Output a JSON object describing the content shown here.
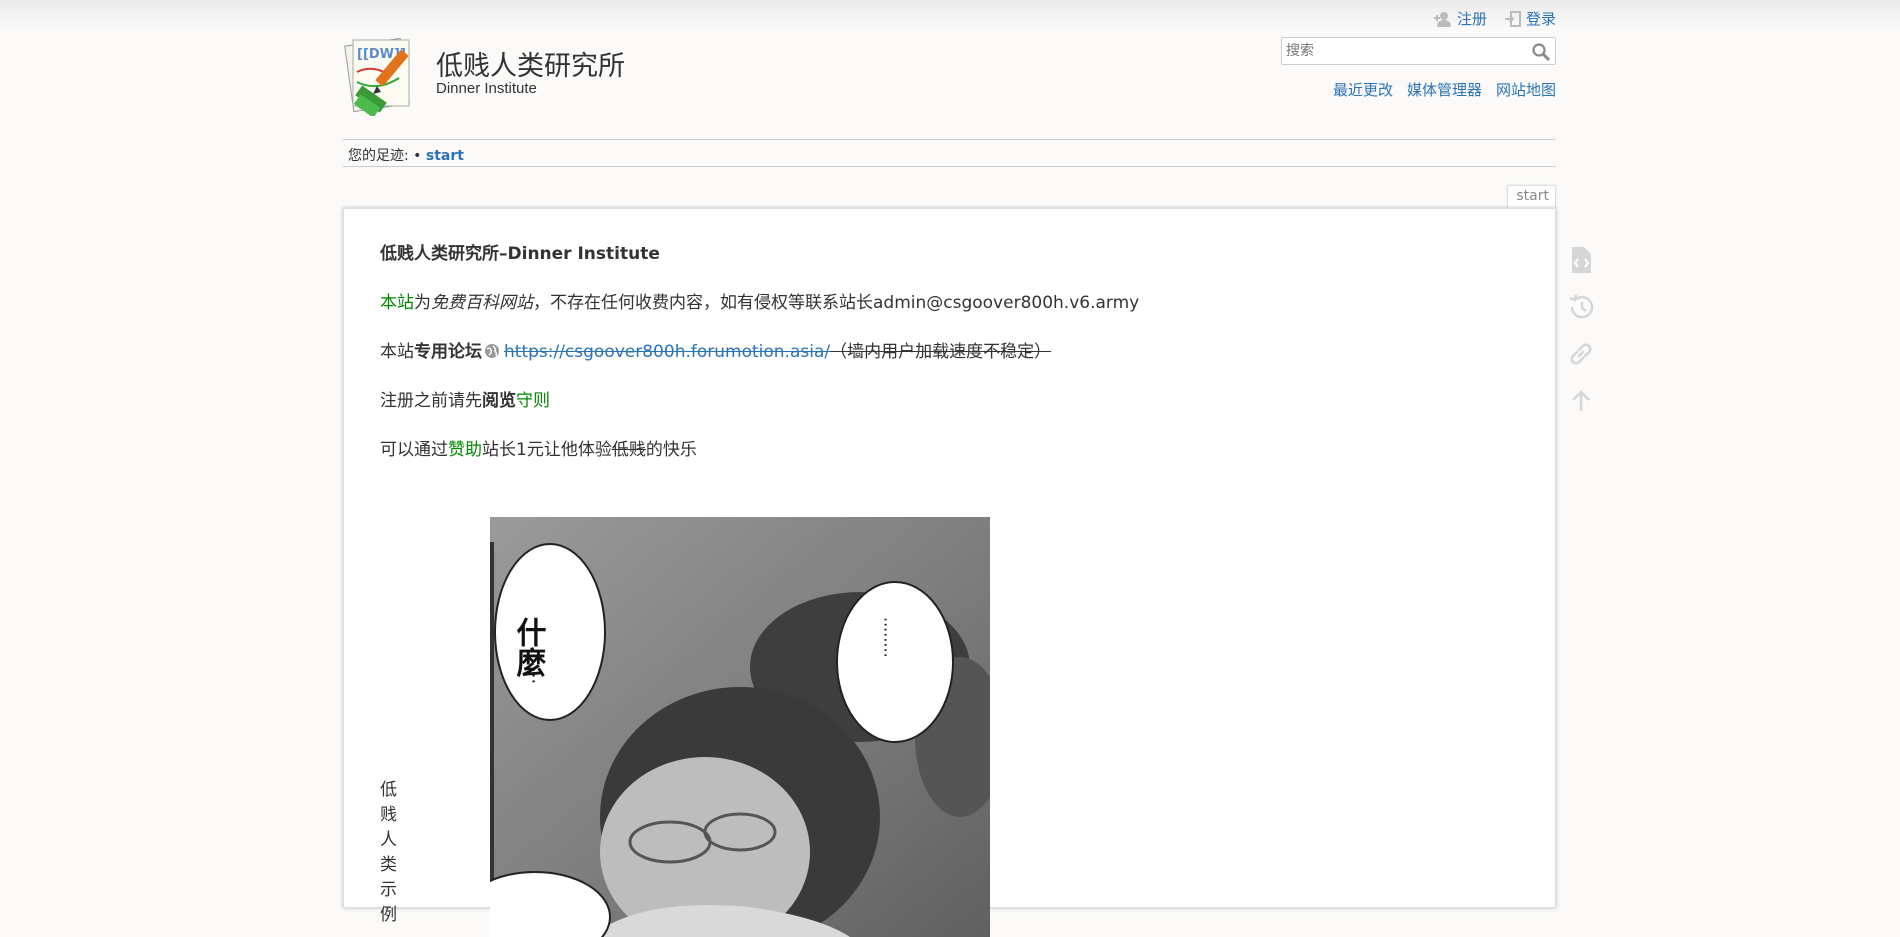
{
  "header": {
    "title": "低贱人类研究所",
    "tagline": "Dinner Institute",
    "logo_text": "[[DW]]"
  },
  "user_tools": {
    "register": "注册",
    "login": "登录"
  },
  "search": {
    "placeholder": "搜索",
    "value": ""
  },
  "site_tools": {
    "recent_changes": "最近更改",
    "media_manager": "媒体管理器",
    "sitemap": "网站地图"
  },
  "breadcrumb": {
    "label": "您的足迹:",
    "separator": "•",
    "current": "start"
  },
  "page_id": "start",
  "content": {
    "heading": "低贱人类研究所–Dinner Institute",
    "p1": {
      "link": "本站",
      "text1": "为",
      "italic": "免费百科网站",
      "text2": "，不存在任何收费内容，如有侵权等联系站长admin@csgoover800h.v6.army"
    },
    "p2": {
      "text1": "本站",
      "bold": "专用论坛",
      "url": "https://csgoover800h.forumotion.asia/",
      "note": "（墙内用户加载速度不稳定）"
    },
    "p3": {
      "text1": "注册之前请先",
      "bold": "阅览",
      "link": "守则"
    },
    "p4": {
      "text1": "可以通过",
      "link": "赞助",
      "text2": "站长1元让他体验",
      "strike": "低贱",
      "text3": "的快乐"
    },
    "caption": "低贱人类示例",
    "bubble_left": "什麼",
    "bubble_left_dots": "...",
    "bubble_right": "........"
  },
  "page_tools": [
    "source-icon",
    "history-icon",
    "backlinks-icon",
    "back-to-top-icon"
  ],
  "colors": {
    "link": "#2b73b7",
    "wikilink": "#008800",
    "background": "#fbfaf9"
  }
}
